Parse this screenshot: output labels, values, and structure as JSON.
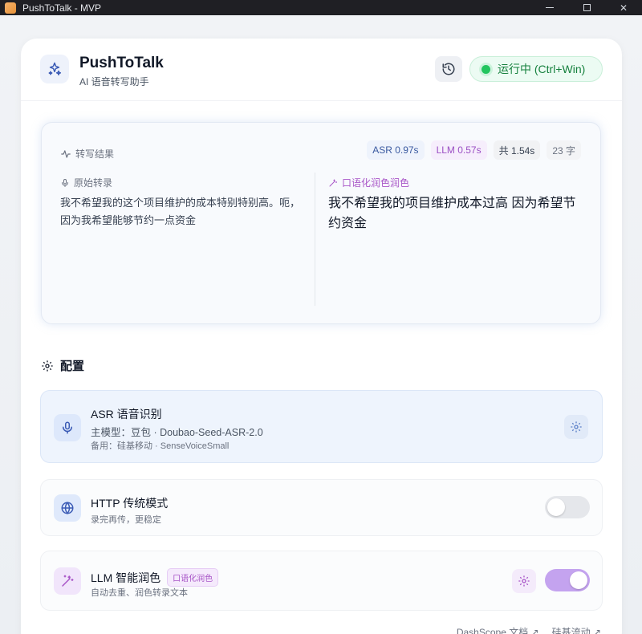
{
  "window": {
    "title": "PushToTalk - MVP",
    "controls": {
      "minimize": "",
      "maximize": "",
      "close": "✕"
    }
  },
  "header": {
    "app_name": "PushToTalk",
    "subtitle": "AI 语音转写助手",
    "status_text": "运行中 (Ctrl+Win)",
    "icons": {
      "logo": "sparkles-icon",
      "history": "history-icon"
    }
  },
  "result": {
    "title": "转写结果",
    "badges": {
      "asr": "ASR 0.97s",
      "llm": "LLM 0.57s",
      "total": "共 1.54s",
      "chars": "23 字"
    },
    "original_label": "原始转录",
    "original_text": "我不希望我的这个项目维护的成本特别特别高。呃，因为我希望能够节约一点资金",
    "polished_label": "口语化润色润色",
    "polished_text": "我不希望我的项目维护成本过高 因为希望节约资金"
  },
  "config": {
    "title": "配置",
    "asr": {
      "title": "ASR 语音识别",
      "primary": "主模型：豆包 · Doubao-Seed-ASR-2.0",
      "backup": "备用：硅基移动 · SenseVoiceSmall"
    },
    "http": {
      "title": "HTTP 传统模式",
      "subtitle": "录完再传，更稳定",
      "enabled": false
    },
    "llm": {
      "title": "LLM 智能润色",
      "tag": "口语化润色",
      "subtitle": "自动去重、润色转录文本",
      "enabled": true
    }
  },
  "footer": {
    "links": [
      "DashScope 文档 ↗",
      "硅基流动 ↗"
    ]
  },
  "colors": {
    "accent_blue": "#3a5aa0",
    "accent_purple": "#a855c7",
    "status_green": "#22c55e"
  }
}
